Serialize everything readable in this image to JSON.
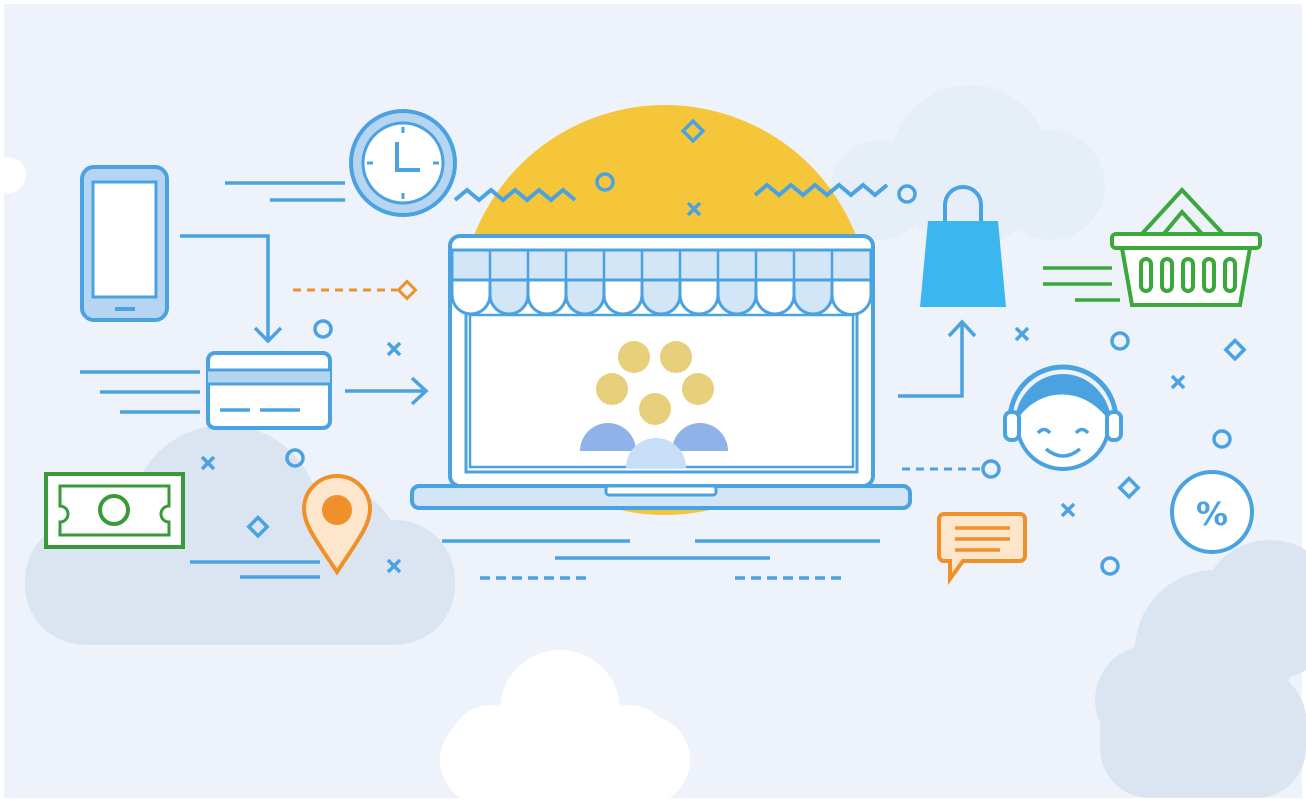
{
  "illustration": {
    "discount_badge": {
      "label": "%"
    }
  },
  "icons": [
    "smartphone-icon",
    "clock-icon",
    "credit-card-icon",
    "cash-bill-icon",
    "location-pin-icon",
    "storefront-laptop-icon",
    "customers-icon",
    "shopping-bag-icon",
    "shopping-basket-icon",
    "support-agent-icon",
    "chat-bubble-icon",
    "discount-badge-icon"
  ],
  "colors": {
    "background": "#eef3fb",
    "cloud": "#dce5f2",
    "cloud_white": "#ffffff",
    "line_blue": "#4aa3e0",
    "sun_yellow": "#f5c53a",
    "accent_orange": "#f0902a",
    "money_green": "#3a9a3a",
    "basket_green": "#3aa83a",
    "customer_gold": "#e7cf7c",
    "customer_blue": "#8fb3e8"
  }
}
